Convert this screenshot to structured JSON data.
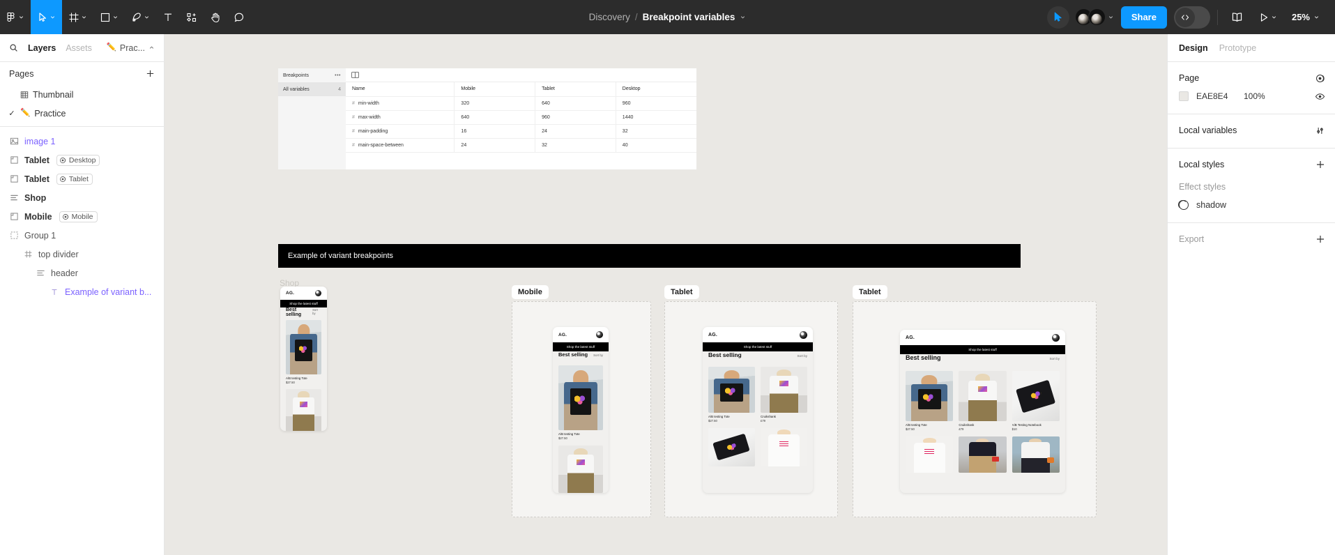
{
  "toolbar": {
    "main_menu": "figma-logo",
    "tools": [
      {
        "name": "move-tool",
        "icon": "cursor"
      },
      {
        "name": "frame-tool",
        "icon": "frame"
      },
      {
        "name": "shape-tool",
        "icon": "square"
      },
      {
        "name": "pen-tool",
        "icon": "pen"
      },
      {
        "name": "text-tool",
        "icon": "text"
      },
      {
        "name": "resources-tool",
        "icon": "components-plus"
      },
      {
        "name": "hand-tool",
        "icon": "hand"
      },
      {
        "name": "comment-tool",
        "icon": "comment"
      }
    ],
    "breadcrumb": {
      "parent": "Discovery",
      "separator": "/",
      "current": "Breakpoint variables"
    },
    "share_label": "Share",
    "zoom_level": "25%",
    "accent_color": "#0D99FF",
    "background_color": "#2C2C2C"
  },
  "left_panel": {
    "tabs": [
      {
        "label": "Layers",
        "active": true
      },
      {
        "label": "Assets",
        "active": false
      }
    ],
    "file_name": "Prac...",
    "file_emoji": "✏️",
    "pages_label": "Pages",
    "pages": [
      {
        "label": "Thumbnail",
        "icon": "thumbnail-icon",
        "selected": false,
        "emoji": ""
      },
      {
        "label": "Practice",
        "icon": "page-icon",
        "selected": true,
        "emoji": "✏️"
      }
    ],
    "layers": [
      {
        "label": "image 1",
        "icon": "image-icon",
        "indent": 0,
        "type": "component",
        "badge": ""
      },
      {
        "label": "Tablet",
        "icon": "frame-icon",
        "indent": 0,
        "type": "frame",
        "badge": "Desktop"
      },
      {
        "label": "Tablet",
        "icon": "frame-icon",
        "indent": 0,
        "type": "frame",
        "badge": "Tablet"
      },
      {
        "label": "Shop",
        "icon": "autolayout-icon",
        "indent": 0,
        "type": "frame",
        "badge": ""
      },
      {
        "label": "Mobile",
        "icon": "frame-icon",
        "indent": 0,
        "type": "frame",
        "badge": "Mobile"
      },
      {
        "label": "Group 1",
        "icon": "group-icon",
        "indent": 0,
        "type": "group",
        "badge": ""
      },
      {
        "label": "top divider",
        "icon": "grid-icon",
        "indent": 1,
        "type": "frame",
        "badge": ""
      },
      {
        "label": "header",
        "icon": "autolayout-icon",
        "indent": 2,
        "type": "frame",
        "badge": ""
      },
      {
        "label": "Example of variant b...",
        "icon": "text-icon",
        "indent": 3,
        "type": "text",
        "badge": ""
      }
    ]
  },
  "right_panel": {
    "tabs": [
      {
        "label": "Design",
        "active": true
      },
      {
        "label": "Prototype",
        "active": false
      }
    ],
    "page_section": {
      "title": "Page",
      "fill_hex": "EAE8E4",
      "fill_opacity": "100%",
      "swatch_color": "#EAE8E4"
    },
    "local_variables_label": "Local variables",
    "local_styles_label": "Local styles",
    "effect_styles_label": "Effect styles",
    "effect_styles": [
      {
        "label": "shadow"
      }
    ],
    "export_label": "Export"
  },
  "canvas": {
    "background_color": "#EAE8E4",
    "variables_table": {
      "collection_name": "Breakpoints",
      "menu_dots": "•••",
      "group_label": "All variables",
      "group_count": "4",
      "columns": [
        "Name",
        "Mobile",
        "Tablet",
        "Desktop"
      ],
      "rows": [
        {
          "name": "min-width",
          "mobile": "320",
          "tablet": "640",
          "desktop": "960"
        },
        {
          "name": "max-width",
          "mobile": "640",
          "tablet": "960",
          "desktop": "1440"
        },
        {
          "name": "main-padding",
          "mobile": "16",
          "tablet": "24",
          "desktop": "32"
        },
        {
          "name": "main-space-between",
          "mobile": "24",
          "tablet": "32",
          "desktop": "40"
        }
      ]
    },
    "banner_text": "Example of variant breakpoints",
    "shop_ghost_label": "Shop",
    "frames": [
      {
        "label": "Mobile"
      },
      {
        "label": "Tablet"
      },
      {
        "label": "Tablet"
      }
    ],
    "mockup": {
      "logo": "AG.",
      "strip_text": "Shop the latest stuff",
      "section_title": "Best selling",
      "sort_label": "Sort by",
      "products": [
        {
          "name": "A/B testing Tote",
          "price": "$27.50",
          "art": "art-tote"
        },
        {
          "name": "Cruikshank",
          "price": "£79",
          "art": "art-hoodie"
        },
        {
          "name": "A/B Testing Notebook",
          "price": "$10",
          "art": "art-note"
        },
        {
          "name": "",
          "price": "",
          "art": "art-tee"
        },
        {
          "name": "",
          "price": "",
          "art": "art-street"
        },
        {
          "name": "",
          "price": "",
          "art": "art-street2"
        }
      ]
    }
  }
}
